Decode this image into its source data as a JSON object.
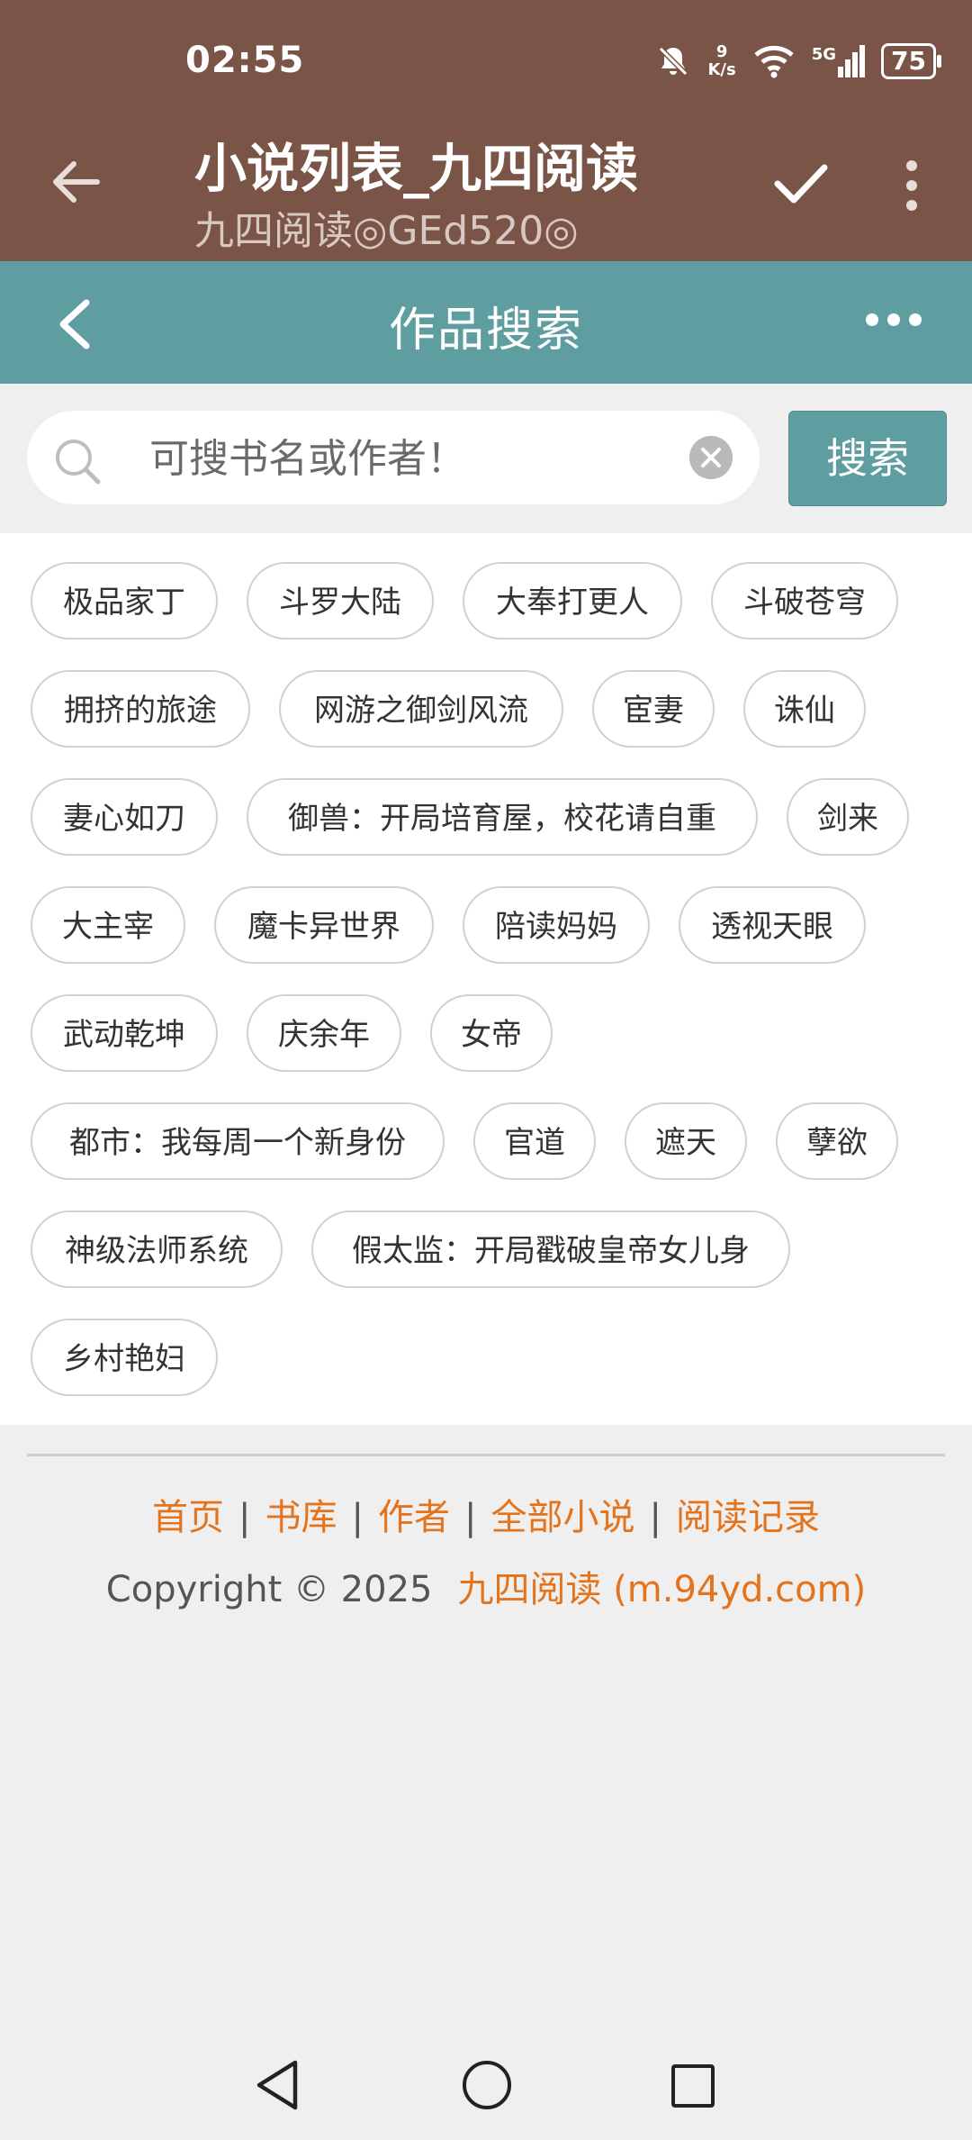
{
  "status_bar": {
    "time": "02:55",
    "net_speed_value": "9",
    "net_speed_unit": "K/s",
    "signal_label": "5G",
    "battery": "75"
  },
  "app_bar": {
    "title": "小说列表_九四阅读",
    "subtitle": "九四阅读◎GEd520◎"
  },
  "site_header": {
    "title": "作品搜索"
  },
  "search": {
    "placeholder": "可搜书名或作者！",
    "button_label": "搜索"
  },
  "tags": [
    "极品家丁",
    "斗罗大陆",
    "大奉打更人",
    "斗破苍穹",
    "拥挤的旅途",
    "网游之御剑风流",
    "宦妻",
    "诛仙",
    "妻心如刀",
    "御兽：开局培育屋，校花请自重",
    "剑来",
    "大主宰",
    "魔卡异世界",
    "陪读妈妈",
    "透视天眼",
    "武动乾坤",
    "庆余年",
    "女帝",
    "都市：我每周一个新身份",
    "官道",
    "遮天",
    "孽欲",
    "神级法师系统",
    "假太监：开局戳破皇帝女儿身",
    "乡村艳妇"
  ],
  "footer": {
    "links": [
      "首页",
      "书库",
      "作者",
      "全部小说",
      "阅读记录"
    ],
    "separator": "|",
    "copyright": "Copyright © 2025",
    "site_name": "九四阅读 (m.94yd.com)"
  },
  "colors": {
    "app_bar": "#7a5446",
    "site_header": "#5e9ea0",
    "link": "#e4731c"
  }
}
